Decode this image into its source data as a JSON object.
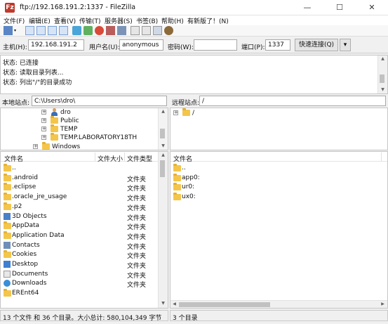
{
  "window": {
    "title": "ftp://192.168.191.2:1337 - FileZilla",
    "app_icon": "Fz",
    "minimize": "—",
    "maximize": "☐",
    "close": "✕"
  },
  "menu": [
    "文件(F)",
    "编辑(E)",
    "查看(V)",
    "传输(T)",
    "服务器(S)",
    "书签(B)",
    "帮助(H)",
    "有新版了！(N)"
  ],
  "quickconnect": {
    "host_label": "主机(H):",
    "host_value": "192.168.191.2",
    "user_label": "用户名(U):",
    "user_value": "anonymous",
    "pass_label": "密码(W):",
    "pass_value": "",
    "port_label": "端口(P):",
    "port_value": "1337",
    "connect_button": "快速连接(Q)",
    "dropdown": "▾"
  },
  "log": [
    "状态:  已连接",
    "状态:  读取目录列表...",
    "状态:  列出\"/\"的目录成功"
  ],
  "local": {
    "site_label": "本地站点:",
    "path": "C:\\Users\\dro\\",
    "tree": [
      {
        "label": "dro",
        "icon": "user-icon"
      },
      {
        "label": "Public",
        "icon": "folder-icon"
      },
      {
        "label": "TEMP",
        "icon": "folder-icon"
      },
      {
        "label": "TEMP.LABORATORY18TH",
        "icon": "folder-icon"
      },
      {
        "label": "Windows",
        "icon": "folder-icon"
      }
    ],
    "headers": {
      "name": "文件名",
      "size": "文件大小",
      "type": "文件类型"
    },
    "files": [
      {
        "name": "..",
        "type": "",
        "icon": "folder"
      },
      {
        "name": ".android",
        "type": "文件夹",
        "icon": "folder"
      },
      {
        "name": ".eclipse",
        "type": "文件夹",
        "icon": "folder"
      },
      {
        "name": ".oracle_jre_usage",
        "type": "文件夹",
        "icon": "folder"
      },
      {
        "name": ".p2",
        "type": "文件夹",
        "icon": "folder"
      },
      {
        "name": "3D Objects",
        "type": "文件夹",
        "icon": "3d"
      },
      {
        "name": "AppData",
        "type": "文件夹",
        "icon": "folder"
      },
      {
        "name": "Application Data",
        "type": "文件夹",
        "icon": "folder"
      },
      {
        "name": "Contacts",
        "type": "文件夹",
        "icon": "contacts"
      },
      {
        "name": "Cookies",
        "type": "文件夹",
        "icon": "folder"
      },
      {
        "name": "Desktop",
        "type": "文件夹",
        "icon": "desktop"
      },
      {
        "name": "Documents",
        "type": "文件夹",
        "icon": "docs"
      },
      {
        "name": "Downloads",
        "type": "文件夹",
        "icon": "downloads"
      },
      {
        "name": "EREnt64",
        "type": "",
        "icon": "folder"
      }
    ],
    "status": "13 个文件 和 36 个目录。大小总计: 580,104,349 字节"
  },
  "remote": {
    "site_label": "远程站点:",
    "path": "/",
    "tree": [
      {
        "label": "/",
        "icon": "folder-icon"
      }
    ],
    "headers": {
      "name": "文件名"
    },
    "files": [
      {
        "name": ".."
      },
      {
        "name": "app0:"
      },
      {
        "name": "ur0:"
      },
      {
        "name": "ux0:"
      }
    ],
    "status": "3 个目录"
  }
}
